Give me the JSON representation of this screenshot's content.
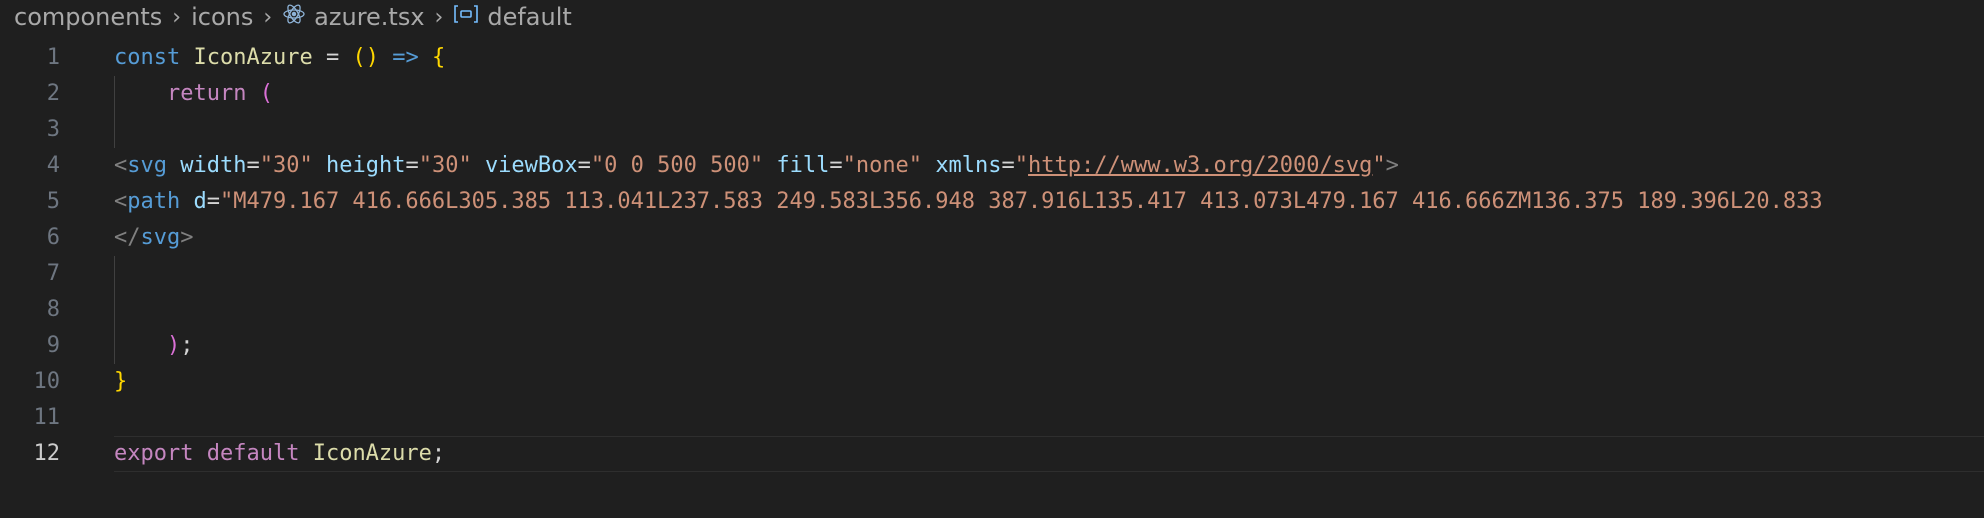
{
  "breadcrumb": {
    "items": [
      {
        "label": "components",
        "icon": ""
      },
      {
        "label": "icons",
        "icon": ""
      },
      {
        "label": "azure.tsx",
        "icon": "react-icon"
      },
      {
        "label": "default",
        "icon": "symbol-variable-icon"
      }
    ],
    "separator": ">"
  },
  "editor": {
    "active_line": "12",
    "lines": [
      {
        "n": "1",
        "tokens": [
          {
            "t": "const",
            "k": "kw"
          },
          {
            "t": " ",
            "k": "plain"
          },
          {
            "t": "IconAzure",
            "k": "fn"
          },
          {
            "t": " ",
            "k": "plain"
          },
          {
            "t": "=",
            "k": "plain"
          },
          {
            "t": " ",
            "k": "plain"
          },
          {
            "t": "()",
            "k": "br1"
          },
          {
            "t": " ",
            "k": "plain"
          },
          {
            "t": "=>",
            "k": "kw"
          },
          {
            "t": " ",
            "k": "plain"
          },
          {
            "t": "{",
            "k": "br1"
          }
        ]
      },
      {
        "n": "2",
        "tokens": [
          {
            "t": "    ",
            "k": "plain"
          },
          {
            "t": "return",
            "k": "ctl"
          },
          {
            "t": " ",
            "k": "plain"
          },
          {
            "t": "(",
            "k": "br2"
          }
        ]
      },
      {
        "n": "3",
        "tokens": []
      },
      {
        "n": "4",
        "tokens": [
          {
            "t": "<",
            "k": "tag-p"
          },
          {
            "t": "svg",
            "k": "tag"
          },
          {
            "t": " ",
            "k": "plain"
          },
          {
            "t": "width",
            "k": "attr"
          },
          {
            "t": "=",
            "k": "plain"
          },
          {
            "t": "\"30\"",
            "k": "str"
          },
          {
            "t": " ",
            "k": "plain"
          },
          {
            "t": "height",
            "k": "attr"
          },
          {
            "t": "=",
            "k": "plain"
          },
          {
            "t": "\"30\"",
            "k": "str"
          },
          {
            "t": " ",
            "k": "plain"
          },
          {
            "t": "viewBox",
            "k": "attr"
          },
          {
            "t": "=",
            "k": "plain"
          },
          {
            "t": "\"0 0 500 500\"",
            "k": "str"
          },
          {
            "t": " ",
            "k": "plain"
          },
          {
            "t": "fill",
            "k": "attr"
          },
          {
            "t": "=",
            "k": "plain"
          },
          {
            "t": "\"none\"",
            "k": "str"
          },
          {
            "t": " ",
            "k": "plain"
          },
          {
            "t": "xmlns",
            "k": "attr"
          },
          {
            "t": "=",
            "k": "plain"
          },
          {
            "t": "\"",
            "k": "str"
          },
          {
            "t": "http://www.w3.org/2000/svg",
            "k": "url"
          },
          {
            "t": "\"",
            "k": "str"
          },
          {
            "t": ">",
            "k": "tag-p"
          }
        ]
      },
      {
        "n": "5",
        "tokens": [
          {
            "t": "<",
            "k": "tag-p"
          },
          {
            "t": "path",
            "k": "tag"
          },
          {
            "t": " ",
            "k": "plain"
          },
          {
            "t": "d",
            "k": "attr"
          },
          {
            "t": "=",
            "k": "plain"
          },
          {
            "t": "\"M479.167 416.666L305.385 113.041L237.583 249.583L356.948 387.916L135.417 413.073L479.167 416.666ZM136.375 189.396L20.833",
            "k": "str"
          }
        ]
      },
      {
        "n": "6",
        "tokens": [
          {
            "t": "</",
            "k": "tag-p"
          },
          {
            "t": "svg",
            "k": "tag"
          },
          {
            "t": ">",
            "k": "tag-p"
          }
        ]
      },
      {
        "n": "7",
        "tokens": []
      },
      {
        "n": "8",
        "tokens": []
      },
      {
        "n": "9",
        "tokens": [
          {
            "t": "    ",
            "k": "plain"
          },
          {
            "t": ")",
            "k": "br2"
          },
          {
            "t": ";",
            "k": "plain"
          }
        ]
      },
      {
        "n": "10",
        "tokens": [
          {
            "t": "}",
            "k": "br1"
          }
        ]
      },
      {
        "n": "11",
        "tokens": []
      },
      {
        "n": "12",
        "tokens": [
          {
            "t": "export",
            "k": "ctl"
          },
          {
            "t": " ",
            "k": "plain"
          },
          {
            "t": "default",
            "k": "ctl"
          },
          {
            "t": " ",
            "k": "plain"
          },
          {
            "t": "IconAzure",
            "k": "fn"
          },
          {
            "t": ";",
            "k": "plain"
          }
        ]
      }
    ]
  },
  "colors": {
    "background": "#1f1f1f",
    "keyword": "#569cd6",
    "control": "#c586c0",
    "function": "#dcdcaa",
    "string": "#ce9178",
    "attribute": "#9cdcfe",
    "bracket_1": "#ffd700",
    "bracket_2": "#da70d6"
  }
}
